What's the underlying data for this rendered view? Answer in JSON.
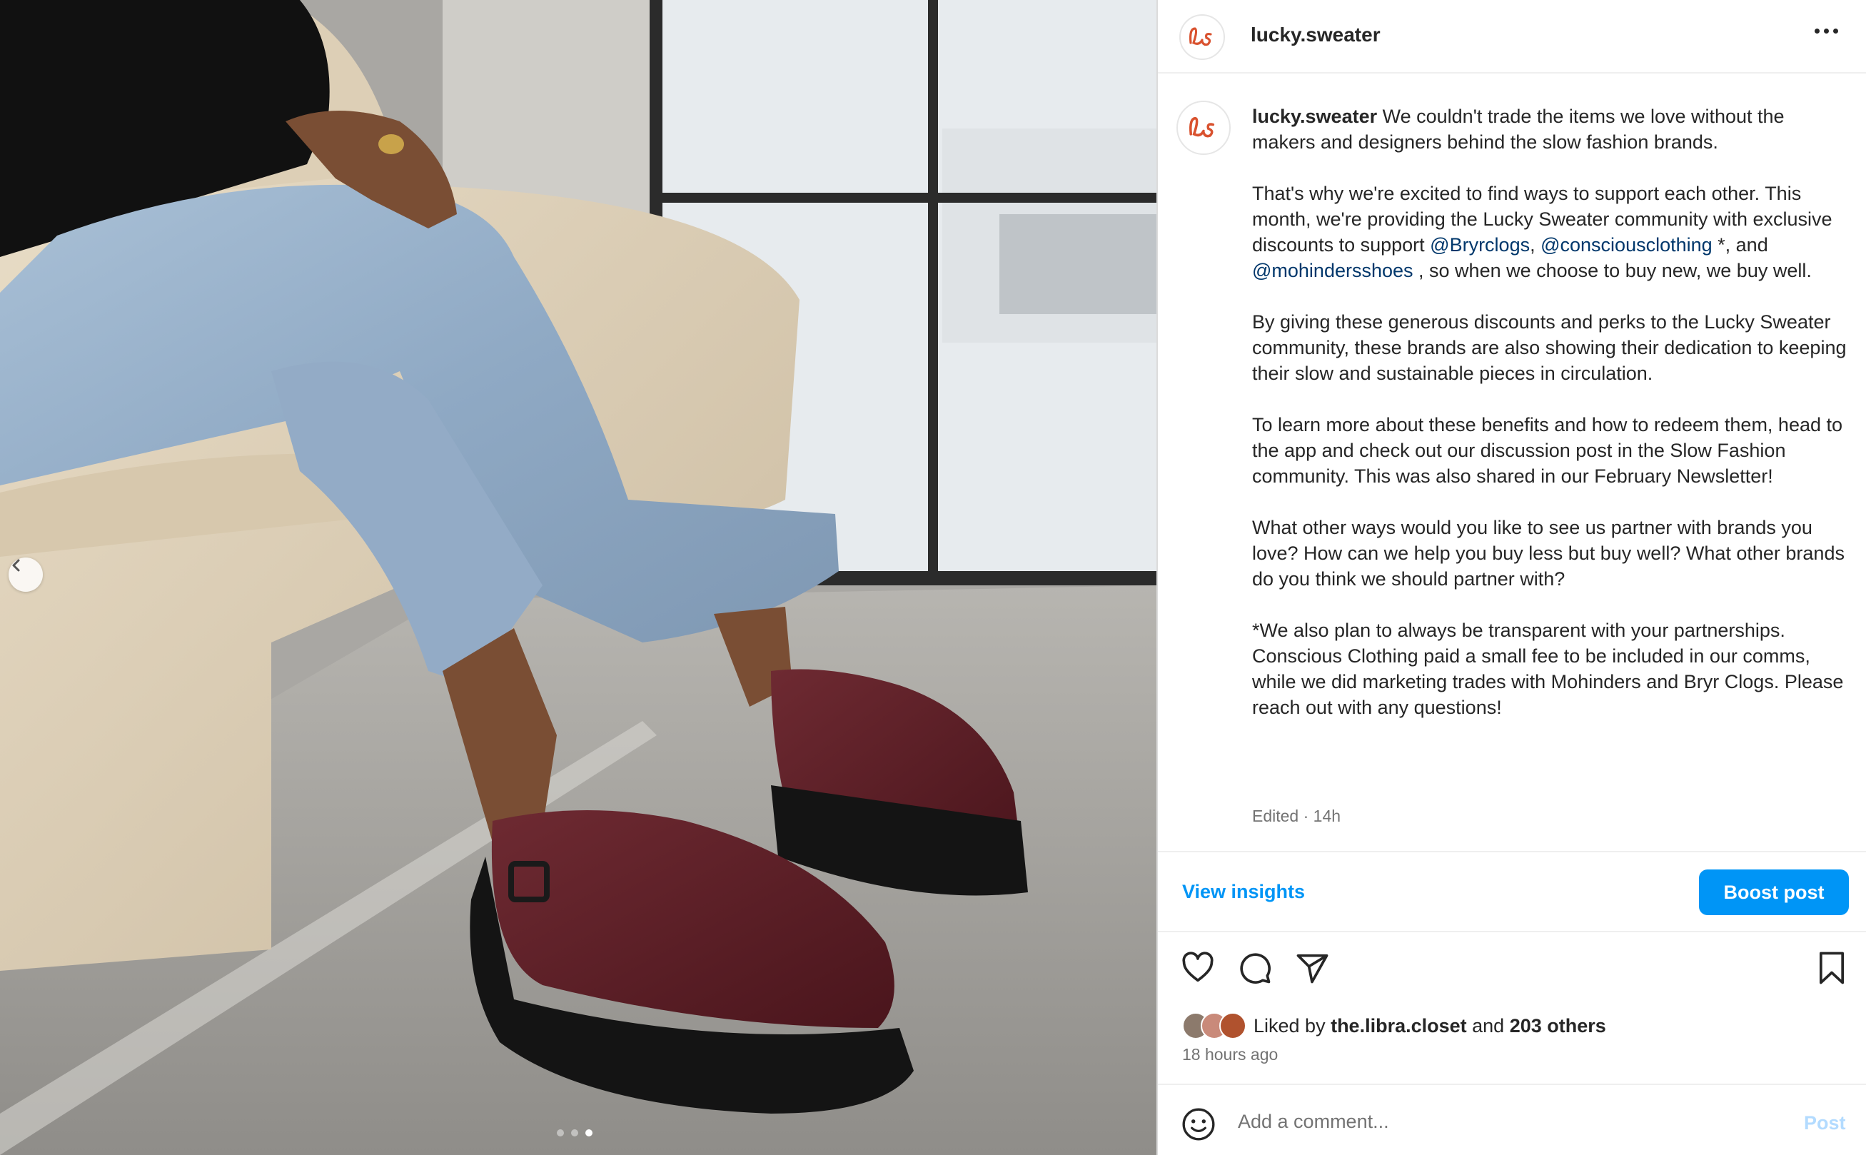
{
  "post": {
    "username": "lucky.sweater",
    "avatar_monogram": "ls",
    "brand_color": "#d9522f",
    "accent_color": "#0095f6",
    "mention_color": "#00376b",
    "image_description": "Person in light-wash cropped jeans and black top sitting on a cream leather armchair, wearing burgundy leather platform clogs, by a window",
    "carousel": {
      "total_slides": 3,
      "active_slide": 3
    }
  },
  "caption": {
    "username": "lucky.sweater",
    "p1": "We couldn't trade the items we love without the makers and designers behind the slow fashion brands.",
    "p2_a": "That's why we're excited to find ways to support each other. This month, we're providing the Lucky Sweater community with exclusive discounts to support ",
    "mention_1": "@Bryrclogs",
    "p2_b": ", ",
    "mention_2": "@consciousclothing",
    "p2_c": " *, and ",
    "mention_3": "@mohindersshoes",
    "p2_d": " , so when we choose to buy new, we buy well.",
    "p3": "By giving these generous discounts and perks to the Lucky Sweater community, these brands are also showing their dedication to keeping their slow and sustainable pieces in circulation.",
    "p4": "To learn more about these benefits and how to redeem them, head to the app and check out our discussion post in the Slow Fashion community. This was also shared in our February Newsletter!",
    "p5": "What other ways would you like to see us partner with brands you love? How can we help you buy less but buy well? What other brands do you think we should partner with?",
    "p6": "*We also plan to always be transparent with your partnerships. Conscious Clothing paid a small fee to be included in our comms, while we did marketing trades with Mohinders and Bryr Clogs. Please reach out with any questions!",
    "edited": "Edited · 14h"
  },
  "insights": {
    "view_label": "View insights",
    "boost_label": "Boost post"
  },
  "actions": {
    "like_icon": "heart-icon",
    "comment_icon": "comment-icon",
    "share_icon": "paper-plane-icon",
    "save_icon": "bookmark-icon"
  },
  "likes": {
    "prefix": "Liked by ",
    "first_user": "the.libra.closet",
    "middle": " and ",
    "others": "203 others"
  },
  "timestamp": "18 hours ago",
  "comment": {
    "placeholder": "Add a comment...",
    "post_label": "Post"
  }
}
